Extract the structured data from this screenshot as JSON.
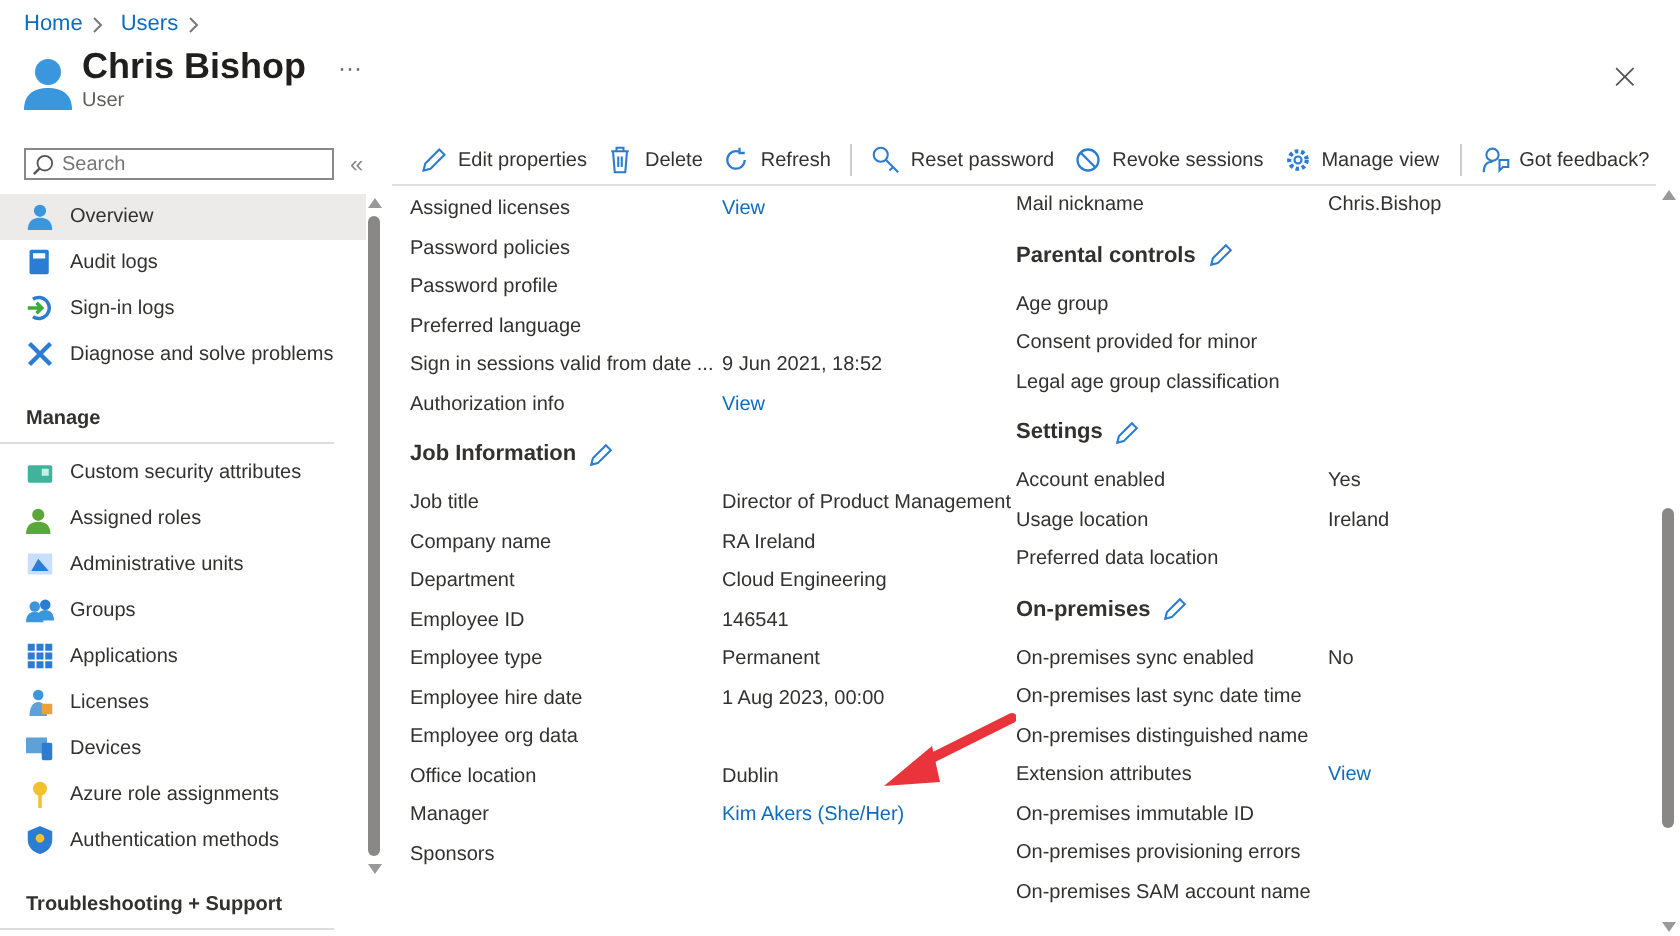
{
  "breadcrumb": [
    "Home",
    "Users"
  ],
  "header": {
    "title": "Chris Bishop",
    "subtitle": "User",
    "more": "···",
    "close": "×"
  },
  "search": {
    "placeholder": "Search"
  },
  "collapse": "«",
  "nav": [
    {
      "kind": "item",
      "label": "Overview",
      "selected": true
    },
    {
      "kind": "item",
      "label": "Audit logs",
      "selected": false
    },
    {
      "kind": "item",
      "label": "Sign-in logs",
      "selected": false
    },
    {
      "kind": "item",
      "label": "Diagnose and solve problems",
      "selected": false
    },
    {
      "kind": "heading",
      "label": "Manage"
    },
    {
      "kind": "item",
      "label": "Custom security attributes",
      "selected": false
    },
    {
      "kind": "item",
      "label": "Assigned roles",
      "selected": false
    },
    {
      "kind": "item",
      "label": "Administrative units",
      "selected": false
    },
    {
      "kind": "item",
      "label": "Groups",
      "selected": false
    },
    {
      "kind": "item",
      "label": "Applications",
      "selected": false
    },
    {
      "kind": "item",
      "label": "Licenses",
      "selected": false
    },
    {
      "kind": "item",
      "label": "Devices",
      "selected": false
    },
    {
      "kind": "item",
      "label": "Azure role assignments",
      "selected": false
    },
    {
      "kind": "item",
      "label": "Authentication methods",
      "selected": false
    },
    {
      "kind": "heading",
      "label": "Troubleshooting + Support"
    }
  ],
  "toolbar": [
    [
      "Edit properties",
      "Delete",
      "Refresh"
    ],
    [
      "Reset password",
      "Revoke sessions",
      "Manage view"
    ],
    [
      "Got feedback?"
    ]
  ],
  "columns": [
    [
      {
        "kind": "field",
        "label": "Assigned licenses",
        "value": "View",
        "link": true
      },
      {
        "kind": "field",
        "label": "Password policies"
      },
      {
        "kind": "field",
        "label": "Password profile"
      },
      {
        "kind": "field",
        "label": "Preferred language"
      },
      {
        "kind": "field",
        "label": "Sign in sessions valid from date ...",
        "value": "9 Jun 2021, 18:52",
        "link": false
      },
      {
        "kind": "field",
        "label": "Authorization info",
        "value": "View",
        "link": true
      },
      {
        "kind": "section",
        "label": "Job Information"
      },
      {
        "kind": "field",
        "label": "Job title",
        "value": "Director of Product Management",
        "link": false
      },
      {
        "kind": "field",
        "label": "Company name",
        "value": "RA Ireland",
        "link": false
      },
      {
        "kind": "field",
        "label": "Department",
        "value": "Cloud Engineering",
        "link": false
      },
      {
        "kind": "field",
        "label": "Employee ID",
        "value": "146541",
        "link": false
      },
      {
        "kind": "field",
        "label": "Employee type",
        "value": "Permanent",
        "link": false
      },
      {
        "kind": "field",
        "label": "Employee hire date",
        "value": "1 Aug 2023, 00:00",
        "link": false
      },
      {
        "kind": "field",
        "label": "Employee org data"
      },
      {
        "kind": "field",
        "label": "Office location",
        "value": "Dublin",
        "link": false
      },
      {
        "kind": "field",
        "label": "Manager",
        "value": "Kim Akers (She/Her)",
        "link": true
      },
      {
        "kind": "field",
        "label": "Sponsors"
      }
    ],
    [
      {
        "kind": "field",
        "label": "Mail nickname",
        "value": "Chris.Bishop",
        "link": false
      },
      {
        "kind": "section",
        "label": "Parental controls"
      },
      {
        "kind": "field",
        "label": "Age group"
      },
      {
        "kind": "field",
        "label": "Consent provided for minor"
      },
      {
        "kind": "field",
        "label": "Legal age group classification"
      },
      {
        "kind": "section",
        "label": "Settings"
      },
      {
        "kind": "field",
        "label": "Account enabled",
        "value": "Yes",
        "link": false
      },
      {
        "kind": "field",
        "label": "Usage location",
        "value": "Ireland",
        "link": false
      },
      {
        "kind": "field",
        "label": "Preferred data location"
      },
      {
        "kind": "section",
        "label": "On-premises"
      },
      {
        "kind": "field",
        "label": "On-premises sync enabled",
        "value": "No",
        "link": false
      },
      {
        "kind": "field",
        "label": "On-premises last sync date time"
      },
      {
        "kind": "field",
        "label": "On-premises distinguished name"
      },
      {
        "kind": "field",
        "label": "Extension attributes",
        "value": "View",
        "link": true
      },
      {
        "kind": "field",
        "label": "On-premises immutable ID"
      },
      {
        "kind": "field",
        "label": "On-premises provisioning errors"
      },
      {
        "kind": "field",
        "label": "On-premises SAM account name"
      }
    ]
  ]
}
